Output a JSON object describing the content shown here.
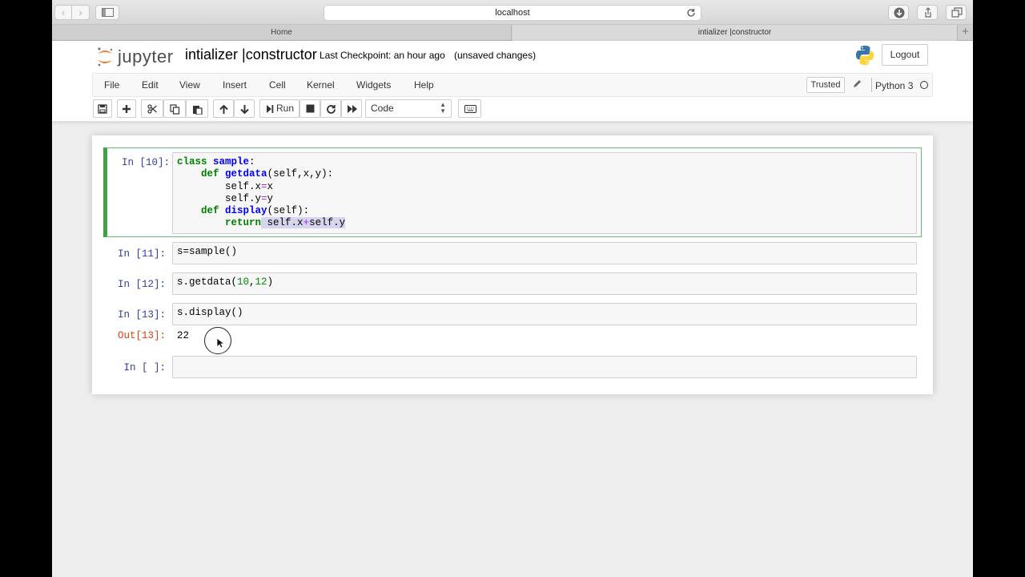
{
  "browser": {
    "url": "localhost",
    "tabs": [
      {
        "label": "Home"
      },
      {
        "label": "intializer |constructor"
      }
    ],
    "new_tab": "+"
  },
  "jupyter": {
    "logo_text": "jupyter",
    "title": "intializer |constructor",
    "checkpoint": "Last Checkpoint: an hour ago",
    "status": "(unsaved changes)",
    "logout_label": "Logout",
    "menu": [
      "File",
      "Edit",
      "View",
      "Insert",
      "Cell",
      "Kernel",
      "Widgets",
      "Help"
    ],
    "trusted_label": "Trusted",
    "kernel_name": "Python 3",
    "run_label": "Run",
    "cell_type": "Code"
  },
  "cells": [
    {
      "prompt": "In [10]:",
      "lines": [
        "class sample:",
        "    def getdata(self,x,y):",
        "        self.x=x",
        "        self.y=y",
        "    def display(self):",
        "        return self.x+self.y"
      ]
    },
    {
      "prompt": "In [11]:",
      "code": "s=sample()"
    },
    {
      "prompt": "In [12]:",
      "code": "s.getdata(10,12)"
    },
    {
      "prompt": "In [13]:",
      "code": "s.display()"
    },
    {
      "out_prompt": "Out[13]:",
      "output": "22"
    },
    {
      "prompt": "In [ ]:",
      "code": ""
    }
  ],
  "colors": {
    "selected_cell_border": "#42a142",
    "prompt_in": "#303f9f",
    "prompt_out": "#d84315",
    "keyword": "#008000"
  }
}
